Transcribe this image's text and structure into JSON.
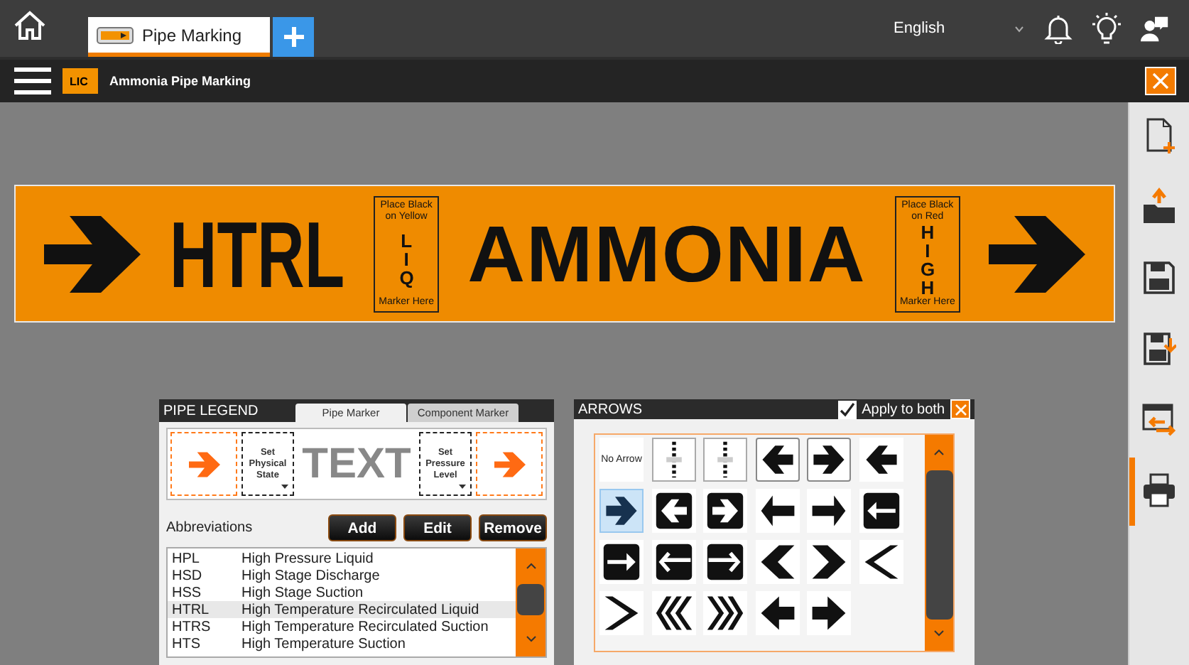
{
  "top_bar": {
    "tabs": [
      {
        "label": "Pipe Marking"
      }
    ],
    "language": "English"
  },
  "document_bar": {
    "logo_text": "LIC",
    "title": "Ammonia Pipe Marking"
  },
  "pipe_marker": {
    "abbreviation": "HTRL",
    "legend": "AMMONIA",
    "state_boxes": [
      {
        "top": "Place Black on Yellow",
        "letters": "LIQ",
        "bottom": "Marker Here"
      },
      {
        "top": "Place Black on Red",
        "letters": "HIGH",
        "bottom": "Marker Here"
      }
    ]
  },
  "legend_panel": {
    "title": "PIPE LEGEND",
    "tabs": [
      {
        "label": "Pipe Marker",
        "selected": true
      },
      {
        "label": "Component Marker",
        "selected": false
      }
    ],
    "preview": {
      "physical_state": "Set Physical State",
      "text": "TEXT",
      "pressure_level": "Set Pressure Level"
    },
    "abbreviations_label": "Abbreviations",
    "buttons": [
      "Add",
      "Edit",
      "Remove"
    ],
    "rows": [
      {
        "code": "HPL",
        "name": "High Pressure Liquid",
        "selected": false
      },
      {
        "code": "HSD",
        "name": "High Stage Discharge",
        "selected": false
      },
      {
        "code": "HSS",
        "name": "High Stage Suction",
        "selected": false
      },
      {
        "code": "HTRL",
        "name": "High Temperature Recirculated Liquid",
        "selected": true
      },
      {
        "code": "HTRS",
        "name": "High Temperature Recirculated Suction",
        "selected": false
      },
      {
        "code": "HTS",
        "name": "High Temperature Suction",
        "selected": false
      }
    ]
  },
  "arrows_panel": {
    "title": "ARROWS",
    "apply_to_both": {
      "label": "Apply to both",
      "checked": true
    },
    "items": [
      {
        "kind": "label",
        "text": "No Arrow",
        "selected": false
      },
      {
        "kind": "tape",
        "selected": false
      },
      {
        "kind": "tape",
        "selected": false
      },
      {
        "kind": "outlined",
        "points_left": true,
        "selected": false
      },
      {
        "kind": "outlined",
        "points_left": false,
        "selected": false
      },
      {
        "kind": "plain",
        "points_left": true,
        "selected": false
      },
      {
        "kind": "plain",
        "points_left": false,
        "selected": true
      },
      {
        "kind": "badge",
        "points_left": true,
        "selected": false
      },
      {
        "kind": "badge",
        "points_left": false,
        "selected": false
      },
      {
        "kind": "bar",
        "points_left": true,
        "selected": false
      },
      {
        "kind": "bar",
        "points_left": false,
        "selected": false
      },
      {
        "kind": "linebadge",
        "points_left": true,
        "selected": false
      },
      {
        "kind": "linebadge",
        "points_left": false,
        "selected": false
      },
      {
        "kind": "longbadge",
        "points_left": true,
        "selected": false
      },
      {
        "kind": "longbadge",
        "points_left": false,
        "selected": false
      },
      {
        "kind": "chevron",
        "points_left": true,
        "selected": false
      },
      {
        "kind": "chevron",
        "points_left": false,
        "selected": false
      },
      {
        "kind": "thinchevron",
        "points_left": true,
        "selected": false
      },
      {
        "kind": "thinchevron",
        "points_left": false,
        "selected": false
      },
      {
        "kind": "multichevron",
        "points_left": true,
        "selected": false
      },
      {
        "kind": "multichevron",
        "points_left": false,
        "selected": false
      },
      {
        "kind": "block",
        "points_left": true,
        "selected": false
      },
      {
        "kind": "block",
        "points_left": false,
        "selected": false
      }
    ]
  }
}
